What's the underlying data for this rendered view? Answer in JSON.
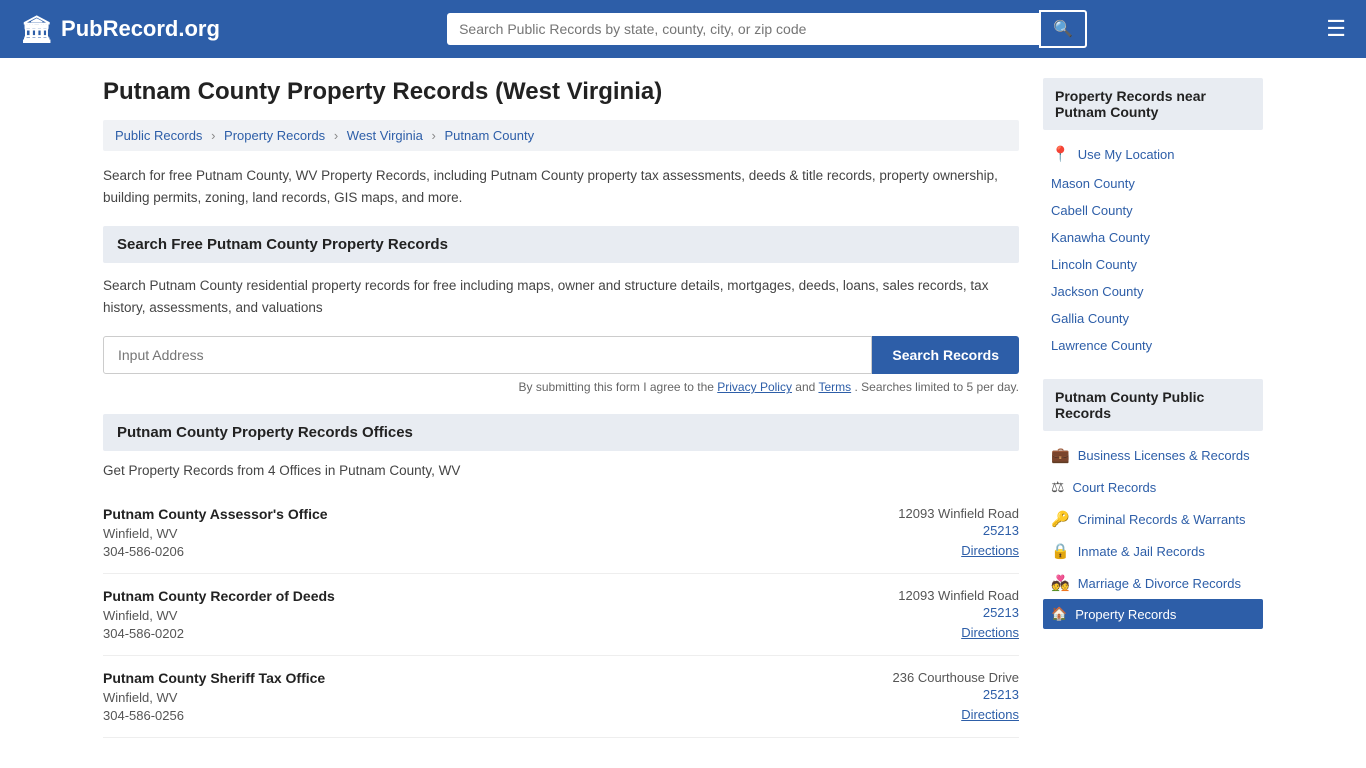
{
  "header": {
    "logo_icon": "🏛",
    "logo_text": "PubRecord.org",
    "search_placeholder": "Search Public Records by state, county, city, or zip code",
    "search_icon": "🔍",
    "menu_icon": "☰"
  },
  "page": {
    "title": "Putnam County Property Records (West Virginia)",
    "breadcrumb": [
      {
        "label": "Public Records",
        "href": "#"
      },
      {
        "label": "Property Records",
        "href": "#"
      },
      {
        "label": "West Virginia",
        "href": "#"
      },
      {
        "label": "Putnam County",
        "href": "#"
      }
    ],
    "description": "Search for free Putnam County, WV Property Records, including Putnam County property tax assessments, deeds & title records, property ownership, building permits, zoning, land records, GIS maps, and more.",
    "search_section_header": "Search Free Putnam County Property Records",
    "search_description": "Search Putnam County residential property records for free including maps, owner and structure details, mortgages, deeds, loans, sales records, tax history, assessments, and valuations",
    "search_input_placeholder": "Input Address",
    "search_button_label": "Search Records",
    "search_note": "By submitting this form I agree to the",
    "search_note_privacy": "Privacy Policy",
    "search_note_and": "and",
    "search_note_terms": "Terms",
    "search_note_limit": ". Searches limited to 5 per day.",
    "offices_section_header": "Putnam County Property Records Offices",
    "offices_intro": "Get Property Records from 4 Offices in Putnam County, WV",
    "offices": [
      {
        "name": "Putnam County Assessor's Office",
        "city": "Winfield, WV",
        "phone": "304-586-0206",
        "address": "12093 Winfield Road",
        "zip": "25213",
        "directions": "Directions"
      },
      {
        "name": "Putnam County Recorder of Deeds",
        "city": "Winfield, WV",
        "phone": "304-586-0202",
        "address": "12093 Winfield Road",
        "zip": "25213",
        "directions": "Directions"
      },
      {
        "name": "Putnam County Sheriff Tax Office",
        "city": "Winfield, WV",
        "phone": "304-586-0256",
        "address": "236 Courthouse Drive",
        "zip": "25213",
        "directions": "Directions"
      }
    ]
  },
  "sidebar": {
    "nearby_title": "Property Records near Putnam County",
    "nearby_links": [
      {
        "label": "Use My Location",
        "icon": "📍"
      },
      {
        "label": "Mason County"
      },
      {
        "label": "Cabell County"
      },
      {
        "label": "Kanawha County"
      },
      {
        "label": "Lincoln County"
      },
      {
        "label": "Jackson County"
      },
      {
        "label": "Gallia County"
      },
      {
        "label": "Lawrence County"
      }
    ],
    "public_records_title": "Putnam County Public Records",
    "public_records_links": [
      {
        "label": "Business Licenses & Records",
        "icon": "💼"
      },
      {
        "label": "Court Records",
        "icon": "⚖"
      },
      {
        "label": "Criminal Records & Warrants",
        "icon": "🔑"
      },
      {
        "label": "Inmate & Jail Records",
        "icon": "🔒"
      },
      {
        "label": "Marriage & Divorce Records",
        "icon": "💑"
      },
      {
        "label": "Property Records",
        "icon": "🏠",
        "active": true
      }
    ]
  }
}
